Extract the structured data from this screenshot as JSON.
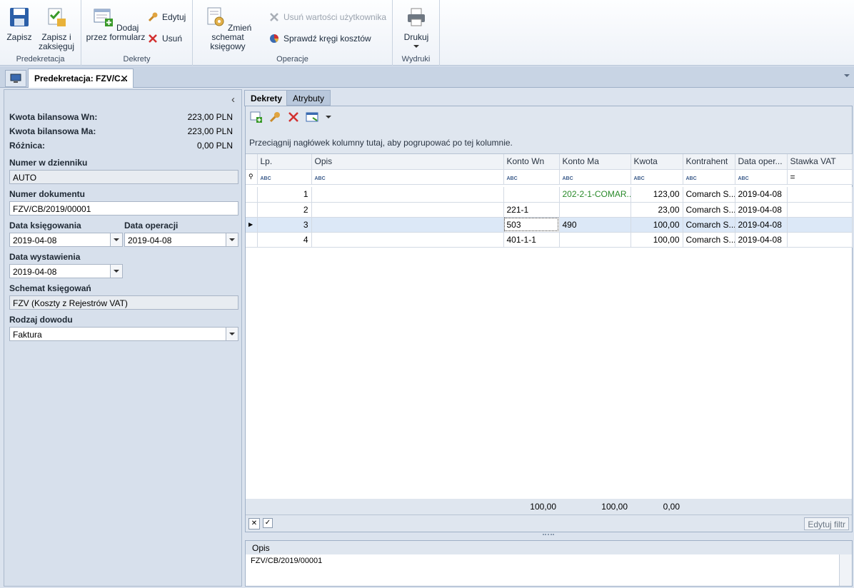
{
  "ribbon": {
    "groups": [
      {
        "label": "Predekretacja",
        "buttons": [
          "Zapisz",
          "Zapisz i zaksięguj"
        ]
      },
      {
        "label": "Dekrety",
        "buttons": [
          "Dodaj przez formularz"
        ],
        "small": [
          "Edytuj",
          "Usuń"
        ]
      },
      {
        "label": "Operacje",
        "buttons": [
          "Zmień schemat księgowy"
        ],
        "small": [
          "Usuń wartości użytkownika",
          "Sprawdź kręgi kosztów"
        ]
      },
      {
        "label": "Wydruki",
        "buttons": [
          "Drukuj"
        ]
      }
    ]
  },
  "tabs": {
    "document": "Predekretacja: FZV/C...",
    "close": "✕"
  },
  "left": {
    "kwota_wn_label": "Kwota bilansowa Wn:",
    "kwota_wn": "223,00 PLN",
    "kwota_ma_label": "Kwota bilansowa Ma:",
    "kwota_ma": "223,00 PLN",
    "roznica_label": "Różnica:",
    "roznica": "0,00 PLN",
    "numer_dziennik_label": "Numer w dzienniku",
    "numer_dziennik": "AUTO",
    "numer_dokumentu_label": "Numer dokumentu",
    "numer_dokumentu": "FZV/CB/2019/00001",
    "data_ksiegowania_label": "Data księgowania",
    "data_ksiegowania": "2019-04-08",
    "data_operacji_label": "Data operacji",
    "data_operacji": "2019-04-08",
    "data_wystawienia_label": "Data wystawienia",
    "data_wystawienia": "2019-04-08",
    "schemat_label": "Schemat księgowań",
    "schemat": "FZV (Koszty z Rejestrów VAT)",
    "rodzaj_label": "Rodzaj dowodu",
    "rodzaj": "Faktura",
    "collapse": "‹"
  },
  "detail_tabs": [
    "Dekrety",
    "Atrybuty"
  ],
  "grid": {
    "group_hint": "Przeciągnij nagłówek kolumny tutaj, aby pogrupować po tej kolumnie.",
    "columns": [
      "Lp.",
      "Opis",
      "Konto Wn",
      "Konto Ma",
      "Kwota",
      "Kontrahent",
      "Data oper...",
      "Stawka VAT"
    ],
    "filter_abc": "ABC",
    "filter_eq": "=",
    "rows": [
      {
        "lp": "1",
        "opis": "",
        "wn": "",
        "ma": "202-2-1-COMAR...",
        "kwota": "123,00",
        "kontrahent": "Comarch S...",
        "data": "2019-04-08",
        "vat": ""
      },
      {
        "lp": "2",
        "opis": "",
        "wn": "221-1",
        "ma": "",
        "kwota": "23,00",
        "kontrahent": "Comarch S...",
        "data": "2019-04-08",
        "vat": ""
      },
      {
        "lp": "3",
        "opis": "",
        "wn": "503",
        "ma": "490",
        "kwota": "100,00",
        "kontrahent": "Comarch S...",
        "data": "2019-04-08",
        "vat": ""
      },
      {
        "lp": "4",
        "opis": "",
        "wn": "401-1-1",
        "ma": "",
        "kwota": "100,00",
        "kontrahent": "Comarch S...",
        "data": "2019-04-08",
        "vat": ""
      }
    ],
    "totals": {
      "wn": "100,00",
      "ma": "100,00",
      "kwota": "0,00"
    },
    "edit_filter": "Edytuj filtr"
  },
  "opis": {
    "label": "Opis",
    "value": "FZV/CB/2019/00001"
  }
}
